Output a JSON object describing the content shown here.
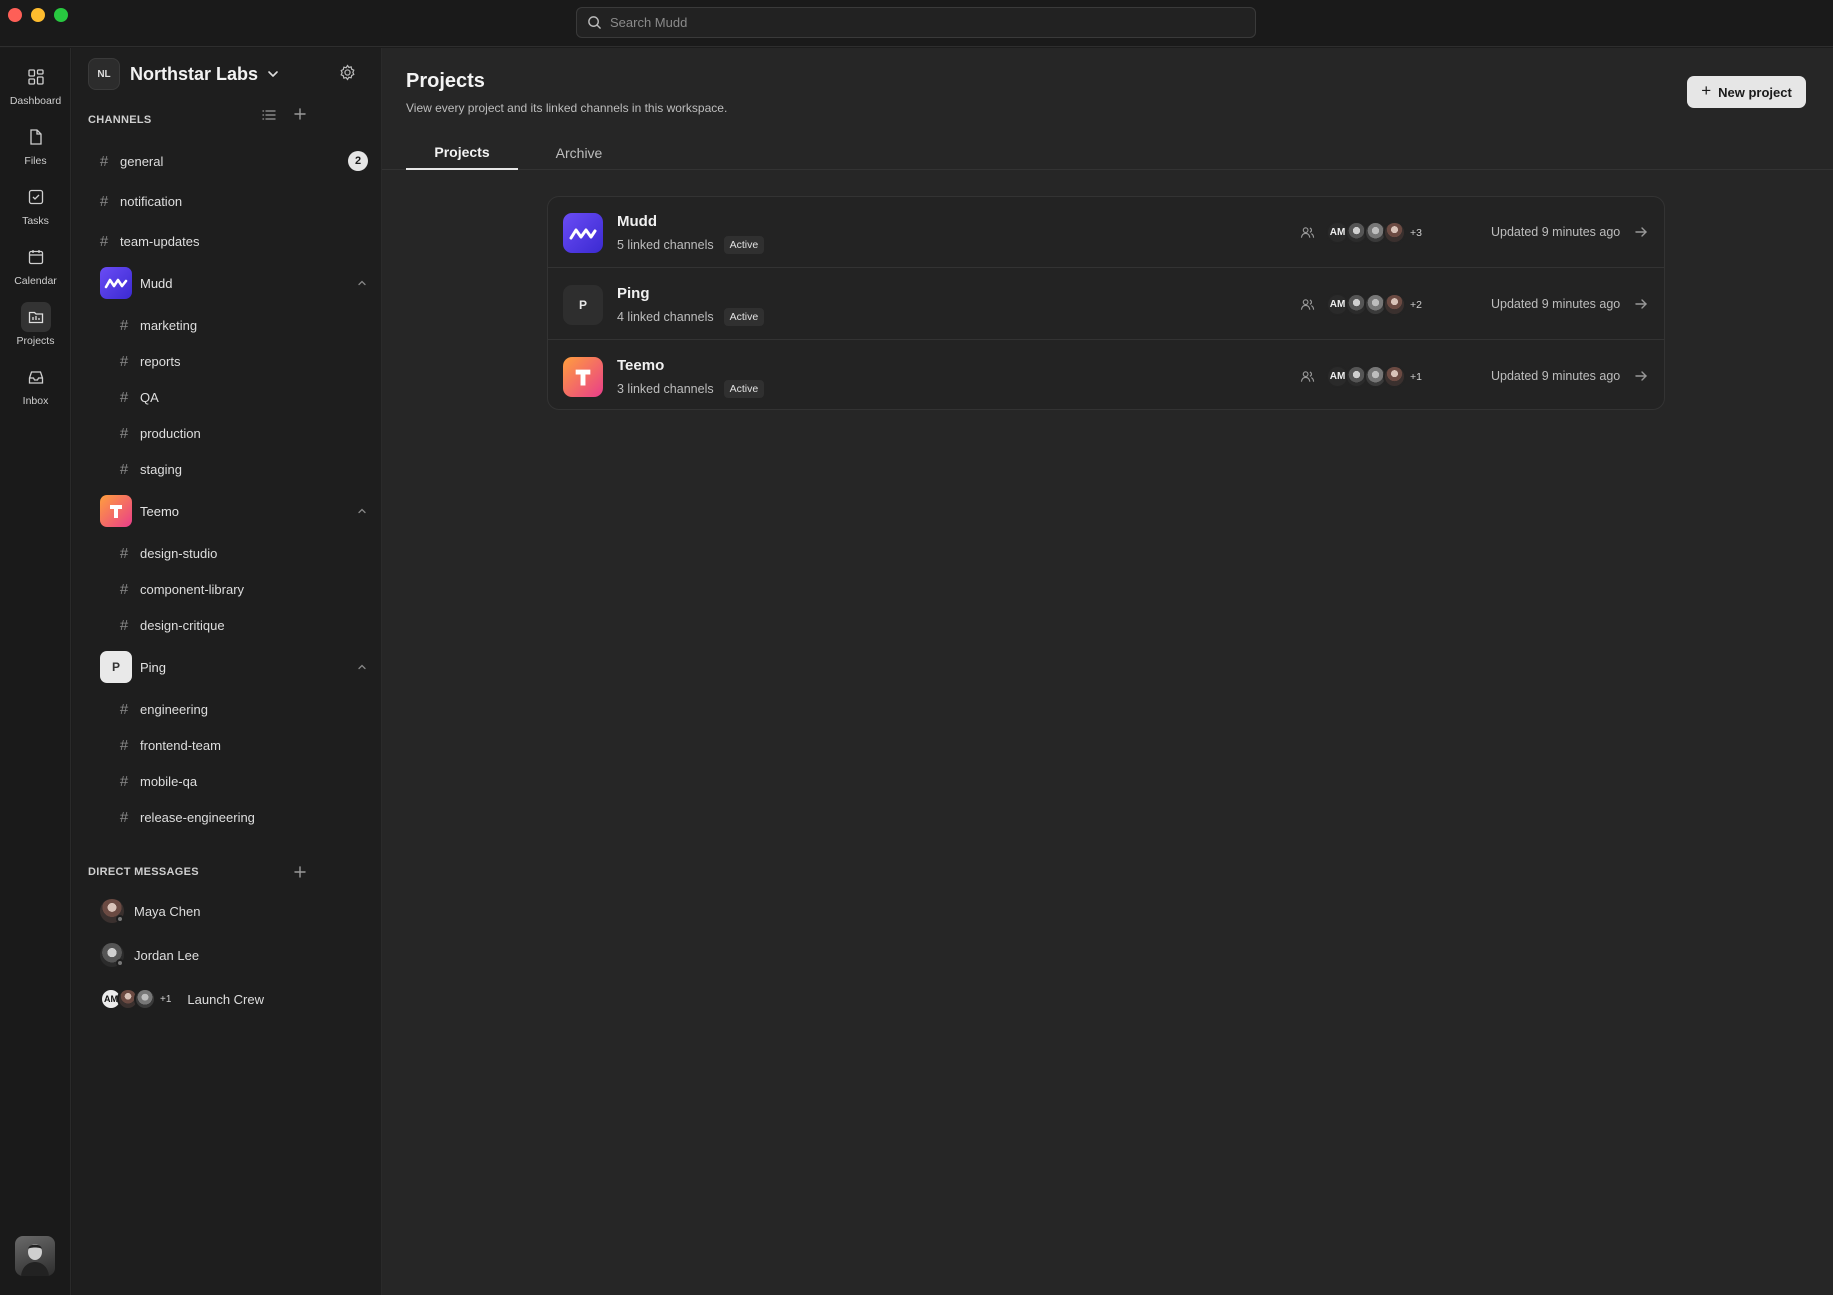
{
  "search": {
    "placeholder": "Search Mudd"
  },
  "rail": {
    "items": [
      {
        "label": "Dashboard",
        "icon": "dashboard-icon"
      },
      {
        "label": "Files",
        "icon": "file-icon"
      },
      {
        "label": "Tasks",
        "icon": "task-check-icon"
      },
      {
        "label": "Calendar",
        "icon": "calendar-icon"
      },
      {
        "label": "Projects",
        "icon": "projects-folder-icon",
        "active": true
      },
      {
        "label": "Inbox",
        "icon": "inbox-icon"
      }
    ]
  },
  "workspace": {
    "initials": "NL",
    "name": "Northstar Labs"
  },
  "channels_section": {
    "label": "CHANNELS",
    "channels": [
      {
        "name": "general",
        "unread": "2"
      },
      {
        "name": "notification"
      },
      {
        "name": "team-updates"
      }
    ],
    "projects": [
      {
        "name": "Mudd",
        "logo": "mudd-logo",
        "channels": [
          "marketing",
          "reports",
          "QA",
          "production",
          "staging"
        ]
      },
      {
        "name": "Teemo",
        "logo": "teemo-logo",
        "channels": [
          "design-studio",
          "component-library",
          "design-critique"
        ]
      },
      {
        "name": "Ping",
        "logo_letter": "P",
        "channels": [
          "engineering",
          "frontend-team",
          "mobile-qa",
          "release-engineering"
        ]
      }
    ]
  },
  "dm_section": {
    "label": "DIRECT MESSAGES",
    "items": [
      {
        "name": "Maya Chen"
      },
      {
        "name": "Jordan Lee"
      },
      {
        "name": "Launch Crew",
        "group_initials": "AM",
        "extra": "+1"
      }
    ]
  },
  "main": {
    "title": "Projects",
    "subtitle": "View every project and its linked channels in this workspace.",
    "new_button": "New project",
    "tabs": [
      {
        "label": "Projects",
        "active": true
      },
      {
        "label": "Archive",
        "active": false
      }
    ],
    "projects": [
      {
        "name": "Mudd",
        "linked": "5 linked channels",
        "status": "Active",
        "owner_initials": "AM",
        "extra_members": "+3",
        "updated": "Updated 9 minutes ago"
      },
      {
        "name": "Ping",
        "logo_letter": "P",
        "linked": "4 linked channels",
        "status": "Active",
        "owner_initials": "AM",
        "extra_members": "+2",
        "updated": "Updated 9 minutes ago"
      },
      {
        "name": "Teemo",
        "linked": "3 linked channels",
        "status": "Active",
        "owner_initials": "AM",
        "extra_members": "+1",
        "updated": "Updated 9 minutes ago"
      }
    ]
  },
  "colors": {
    "background": "#262626",
    "sidebar": "#1e1e1e",
    "mudd_brand": "#5b3df0",
    "teemo_brand_from": "#ff9f3d",
    "teemo_brand_to": "#e93d8a",
    "primary_button": "#e6e6e6"
  }
}
